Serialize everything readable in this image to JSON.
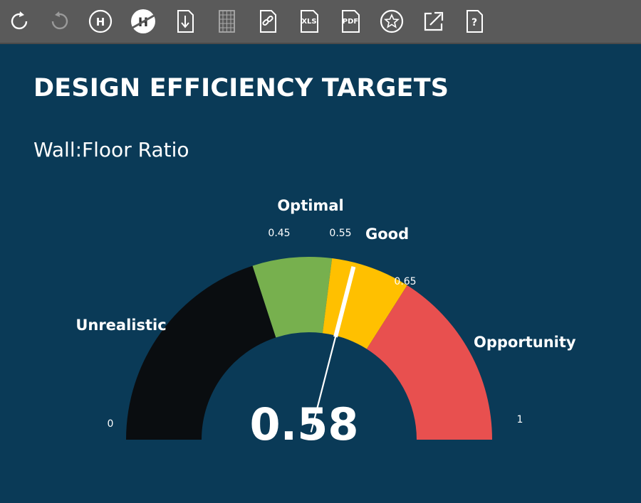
{
  "toolbar": {
    "buttons": [
      {
        "name": "refresh-icon",
        "label": ""
      },
      {
        "name": "undo-icon",
        "label": ""
      },
      {
        "name": "highlight-icon",
        "label": "H"
      },
      {
        "name": "unhighlight-icon",
        "label": "H"
      },
      {
        "name": "download-icon",
        "label": ""
      },
      {
        "name": "crosstab-icon",
        "label": ""
      },
      {
        "name": "link-icon",
        "label": ""
      },
      {
        "name": "xls-export-icon",
        "label": "XLS"
      },
      {
        "name": "pdf-export-icon",
        "label": "PDF"
      },
      {
        "name": "favorite-icon",
        "label": ""
      },
      {
        "name": "expand-icon",
        "label": ""
      },
      {
        "name": "help-icon",
        "label": "?"
      }
    ]
  },
  "main": {
    "title": "DESIGN EFFICIENCY TARGETS",
    "subtitle": "Wall:Floor Ratio"
  },
  "chart_data": {
    "type": "gauge",
    "title": "DESIGN EFFICIENCY TARGETS",
    "subtitle": "Wall:Floor Ratio",
    "min": 0,
    "max": 1,
    "min_label": "0",
    "max_label": "1",
    "value": 0.58,
    "value_label": "0.58",
    "bands": [
      {
        "name": "Unrealistic",
        "from": 0,
        "to": 0.4,
        "color": "#0a0d10"
      },
      {
        "name": "Optimal",
        "from": 0.4,
        "to": 0.54,
        "color": "#77b04e"
      },
      {
        "name": "Good",
        "from": 0.54,
        "to": 0.68,
        "color": "#ffc000"
      },
      {
        "name": "Opportunity",
        "from": 0.68,
        "to": 1,
        "color": "#e8504f"
      }
    ],
    "tick_labels": [
      "0.45",
      "0.55",
      "0.65"
    ],
    "needle_color": "#ffffff",
    "background": "#0a3a57"
  }
}
